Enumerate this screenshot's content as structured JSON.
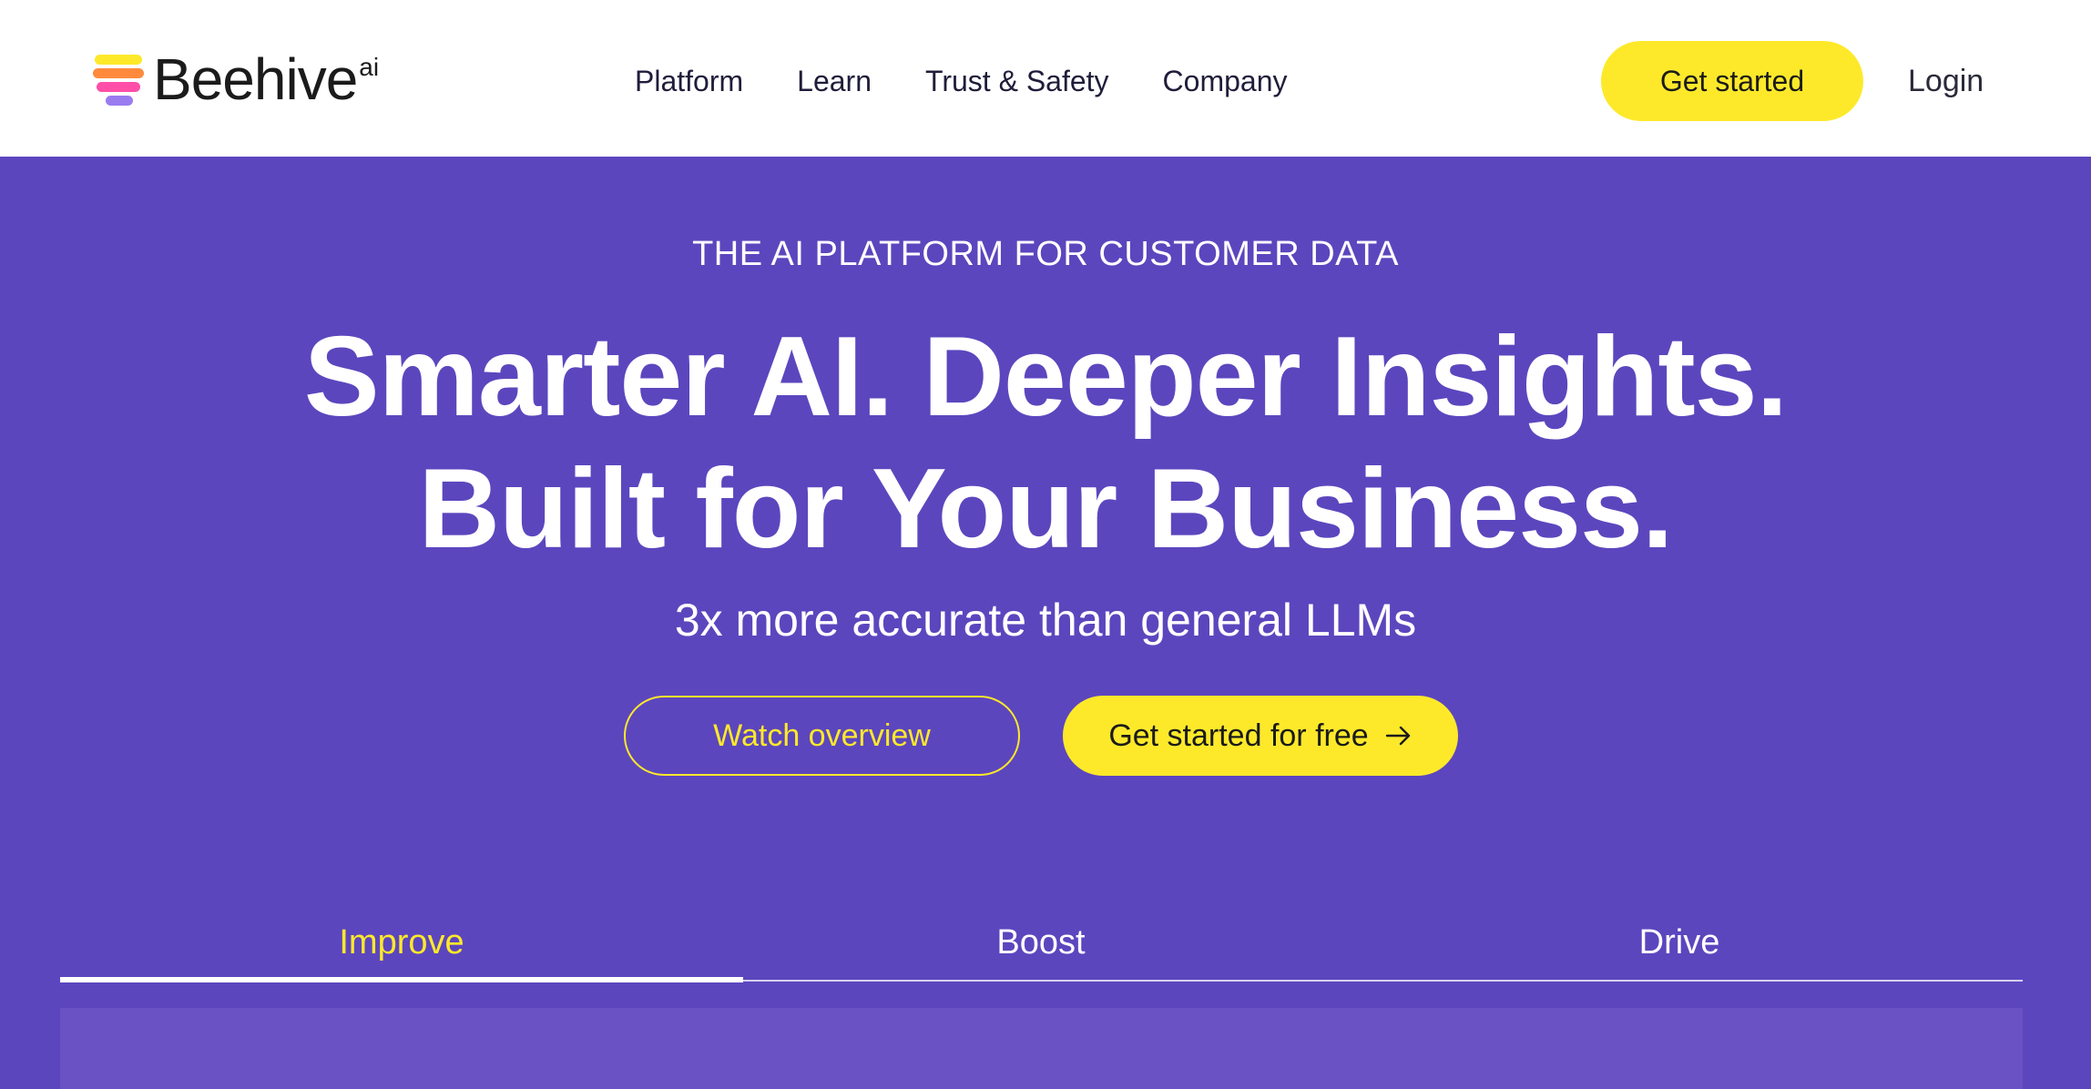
{
  "navbar": {
    "logo": {
      "word": "Beehive",
      "superscript": "ai"
    },
    "links": [
      "Platform",
      "Learn",
      "Trust & Safety",
      "Company"
    ],
    "cta_label": "Get started",
    "login_label": "Login"
  },
  "hero": {
    "eyebrow": "THE AI PLATFORM FOR CUSTOMER DATA",
    "headline_line1": "Smarter AI. Deeper Insights.",
    "headline_line2": "Built for Your Business.",
    "subhead": "3x more accurate than general LLMs",
    "watch_label": "Watch overview",
    "free_label": "Get started for free"
  },
  "tabs": {
    "items": [
      "Improve",
      "Boost",
      "Drive"
    ],
    "active": "Improve"
  },
  "colors": {
    "brand_purple": "#5c46be",
    "accent_yellow": "#fde92a",
    "nav_text": "#1f1d3a",
    "white": "#ffffff"
  },
  "icons": {
    "logo": "beehive-logo-icon",
    "arrow": "arrow-right-icon"
  }
}
